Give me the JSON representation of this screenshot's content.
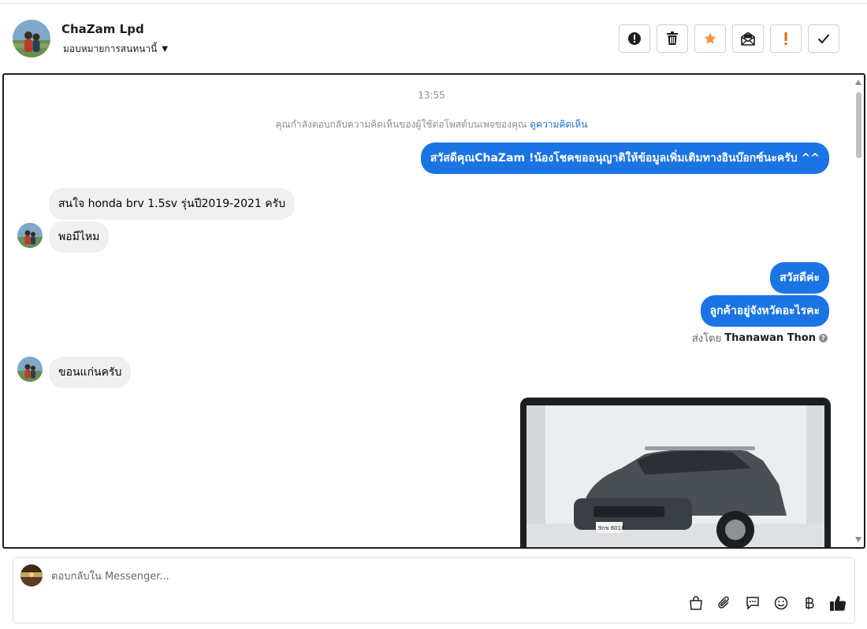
{
  "header": {
    "contact_name": "ChaZam Lpd",
    "assign_label": "มอบหมายการสนทนานี้"
  },
  "actions": [
    {
      "name": "mark-spam-button",
      "icon": "exclamation-circle-icon"
    },
    {
      "name": "delete-button",
      "icon": "trash-icon"
    },
    {
      "name": "star-button",
      "icon": "star-icon",
      "color": "#f7923b"
    },
    {
      "name": "mark-unread-button",
      "icon": "envelope-icon"
    },
    {
      "name": "follow-up-button",
      "icon": "exclamation-icon",
      "color": "#e4670c"
    },
    {
      "name": "mark-done-button",
      "icon": "check-icon"
    }
  ],
  "conversation": {
    "timestamp": "13:55",
    "notice_text": "คุณกำลังตอบกลับความคิดเห็นของผู้ใช้ต่อโพสต์บนเพจของคุณ",
    "notice_link": "ดูความคิดเห็น",
    "messages": [
      {
        "from": "page",
        "text": "สวัสดีคุณChaZam !น้องโชคขออนุญาติให้ข้อมูลเพิ่มเติมทางอินบ๊อกซ์นะครับ ^^"
      },
      {
        "from": "customer",
        "text": "สนใจ honda brv 1.5sv รุ่นปี2019-2021 ครับ"
      },
      {
        "from": "customer",
        "text": "พอมีไหม"
      },
      {
        "from": "page",
        "text": "สวัสดีค่ะ"
      },
      {
        "from": "page",
        "text": "ลูกค้าอยู่จังหวัดอะไรคะ"
      },
      {
        "from": "customer",
        "text": "ขอนแก่นครับ"
      }
    ],
    "sent_by_label": "ส่งโดย",
    "sent_by_name": "Thanawan Thon",
    "car_plate": "9กข 6018"
  },
  "composer": {
    "placeholder": "ตอบกลับใน Messenger..."
  },
  "colors": {
    "outgoing_bubble": "#1b74e4",
    "incoming_bubble": "#f0f0f0",
    "link": "#216fdb"
  }
}
